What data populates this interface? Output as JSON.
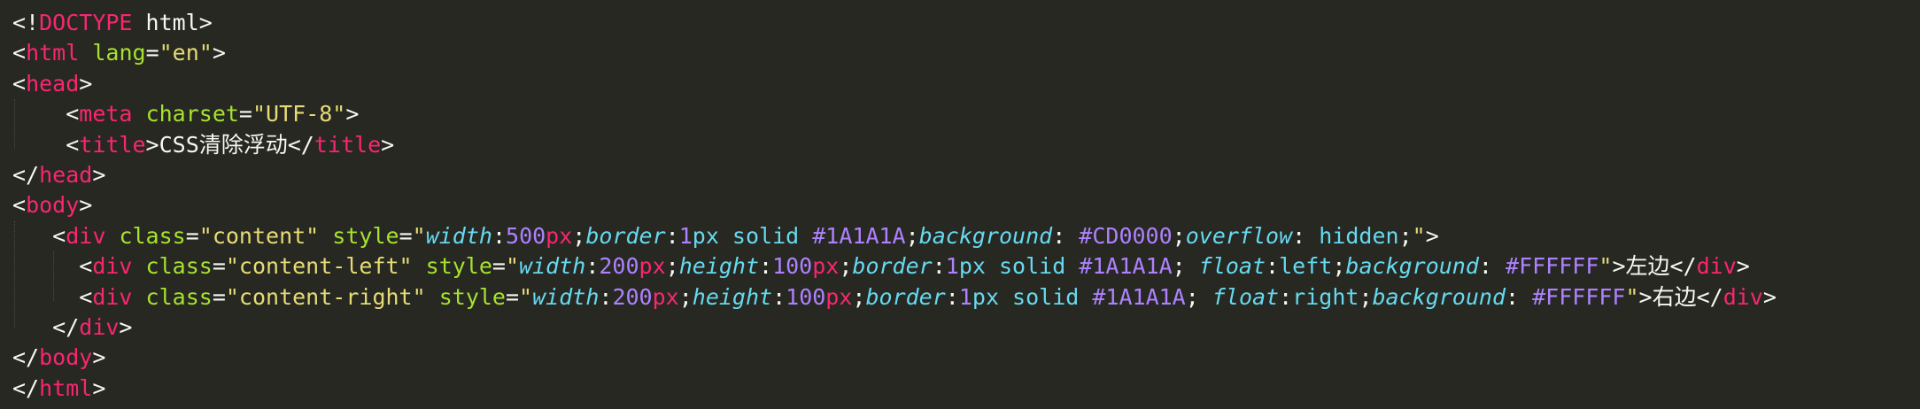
{
  "colors": {
    "background": "#272822",
    "plain": "#F8F8F2",
    "tag": "#F92672",
    "attribute": "#A6E22E",
    "string": "#E6DB74",
    "property": "#66D9EF",
    "number": "#AE81FF"
  },
  "lines": [
    {
      "indent": 0,
      "tokens": [
        [
          "plain",
          "<!"
        ],
        [
          "tag",
          "DOCTYPE"
        ],
        [
          "plain",
          " html>"
        ]
      ]
    },
    {
      "indent": 0,
      "tokens": [
        [
          "plain",
          "<"
        ],
        [
          "tag",
          "html"
        ],
        [
          "plain",
          " "
        ],
        [
          "attr",
          "lang"
        ],
        [
          "plain",
          "="
        ],
        [
          "str",
          "\"en\""
        ],
        [
          "plain",
          ">"
        ]
      ]
    },
    {
      "indent": 0,
      "tokens": [
        [
          "plain",
          "<"
        ],
        [
          "tag",
          "head"
        ],
        [
          "plain",
          ">"
        ]
      ]
    },
    {
      "indent": 4,
      "tokens": [
        [
          "plain",
          "<"
        ],
        [
          "tag",
          "meta"
        ],
        [
          "plain",
          " "
        ],
        [
          "attr",
          "charset"
        ],
        [
          "plain",
          "="
        ],
        [
          "str",
          "\"UTF-8\""
        ],
        [
          "plain",
          ">"
        ]
      ]
    },
    {
      "indent": 4,
      "tokens": [
        [
          "plain",
          "<"
        ],
        [
          "tag",
          "title"
        ],
        [
          "plain",
          ">CSS清除浮动</"
        ],
        [
          "tag",
          "title"
        ],
        [
          "plain",
          ">"
        ]
      ]
    },
    {
      "indent": 0,
      "tokens": [
        [
          "plain",
          "</"
        ],
        [
          "tag",
          "head"
        ],
        [
          "plain",
          ">"
        ]
      ]
    },
    {
      "indent": 0,
      "tokens": [
        [
          "plain",
          "<"
        ],
        [
          "tag",
          "body"
        ],
        [
          "plain",
          ">"
        ]
      ]
    },
    {
      "indent": 3,
      "tokens": [
        [
          "plain",
          "<"
        ],
        [
          "tag",
          "div"
        ],
        [
          "plain",
          " "
        ],
        [
          "attr",
          "class"
        ],
        [
          "plain",
          "="
        ],
        [
          "str",
          "\"content\""
        ],
        [
          "plain",
          " "
        ],
        [
          "attr",
          "style"
        ],
        [
          "plain",
          "="
        ],
        [
          "str",
          "\""
        ],
        [
          "prop",
          "width"
        ],
        [
          "plain",
          ":"
        ],
        [
          "num",
          "500"
        ],
        [
          "unit",
          "px"
        ],
        [
          "plain",
          ";"
        ],
        [
          "prop",
          "border"
        ],
        [
          "plain",
          ":"
        ],
        [
          "num",
          "1"
        ],
        [
          "val",
          "px solid "
        ],
        [
          "num",
          "#1A1A1A"
        ],
        [
          "plain",
          ";"
        ],
        [
          "prop",
          "background"
        ],
        [
          "plain",
          ": "
        ],
        [
          "num",
          "#CD0000"
        ],
        [
          "plain",
          ";"
        ],
        [
          "prop",
          "overflow"
        ],
        [
          "plain",
          ": "
        ],
        [
          "val",
          "hidden"
        ],
        [
          "plain",
          ";"
        ],
        [
          "str",
          "\""
        ],
        [
          "plain",
          ">"
        ]
      ]
    },
    {
      "indent": 5,
      "tokens": [
        [
          "plain",
          "<"
        ],
        [
          "tag",
          "div"
        ],
        [
          "plain",
          " "
        ],
        [
          "attr",
          "class"
        ],
        [
          "plain",
          "="
        ],
        [
          "str",
          "\"content-left\""
        ],
        [
          "plain",
          " "
        ],
        [
          "attr",
          "style"
        ],
        [
          "plain",
          "="
        ],
        [
          "str",
          "\""
        ],
        [
          "prop",
          "width"
        ],
        [
          "plain",
          ":"
        ],
        [
          "num",
          "200"
        ],
        [
          "unit",
          "px"
        ],
        [
          "plain",
          ";"
        ],
        [
          "prop",
          "height"
        ],
        [
          "plain",
          ":"
        ],
        [
          "num",
          "100"
        ],
        [
          "unit",
          "px"
        ],
        [
          "plain",
          ";"
        ],
        [
          "prop",
          "border"
        ],
        [
          "plain",
          ":"
        ],
        [
          "num",
          "1"
        ],
        [
          "val",
          "px solid "
        ],
        [
          "num",
          "#1A1A1A"
        ],
        [
          "plain",
          "; "
        ],
        [
          "prop",
          "float"
        ],
        [
          "plain",
          ":"
        ],
        [
          "val",
          "left"
        ],
        [
          "plain",
          ";"
        ],
        [
          "prop",
          "background"
        ],
        [
          "plain",
          ": "
        ],
        [
          "num",
          "#FFFFFF"
        ],
        [
          "str",
          "\""
        ],
        [
          "plain",
          ">左边</"
        ],
        [
          "tag",
          "div"
        ],
        [
          "plain",
          ">"
        ]
      ]
    },
    {
      "indent": 5,
      "tokens": [
        [
          "plain",
          "<"
        ],
        [
          "tag",
          "div"
        ],
        [
          "plain",
          " "
        ],
        [
          "attr",
          "class"
        ],
        [
          "plain",
          "="
        ],
        [
          "str",
          "\"content-right\""
        ],
        [
          "plain",
          " "
        ],
        [
          "attr",
          "style"
        ],
        [
          "plain",
          "="
        ],
        [
          "str",
          "\""
        ],
        [
          "prop",
          "width"
        ],
        [
          "plain",
          ":"
        ],
        [
          "num",
          "200"
        ],
        [
          "unit",
          "px"
        ],
        [
          "plain",
          ";"
        ],
        [
          "prop",
          "height"
        ],
        [
          "plain",
          ":"
        ],
        [
          "num",
          "100"
        ],
        [
          "unit",
          "px"
        ],
        [
          "plain",
          ";"
        ],
        [
          "prop",
          "border"
        ],
        [
          "plain",
          ":"
        ],
        [
          "num",
          "1"
        ],
        [
          "val",
          "px solid "
        ],
        [
          "num",
          "#1A1A1A"
        ],
        [
          "plain",
          "; "
        ],
        [
          "prop",
          "float"
        ],
        [
          "plain",
          ":"
        ],
        [
          "val",
          "right"
        ],
        [
          "plain",
          ";"
        ],
        [
          "prop",
          "background"
        ],
        [
          "plain",
          ": "
        ],
        [
          "num",
          "#FFFFFF"
        ],
        [
          "str",
          "\""
        ],
        [
          "plain",
          ">右边</"
        ],
        [
          "tag",
          "div"
        ],
        [
          "plain",
          ">"
        ]
      ]
    },
    {
      "indent": 3,
      "tokens": [
        [
          "plain",
          "</"
        ],
        [
          "tag",
          "div"
        ],
        [
          "plain",
          ">"
        ]
      ]
    },
    {
      "indent": 0,
      "tokens": [
        [
          "plain",
          "</"
        ],
        [
          "tag",
          "body"
        ],
        [
          "plain",
          ">"
        ]
      ]
    },
    {
      "indent": 0,
      "tokens": [
        [
          "plain",
          "</"
        ],
        [
          "tag",
          "html"
        ],
        [
          "plain",
          ">"
        ]
      ]
    }
  ]
}
